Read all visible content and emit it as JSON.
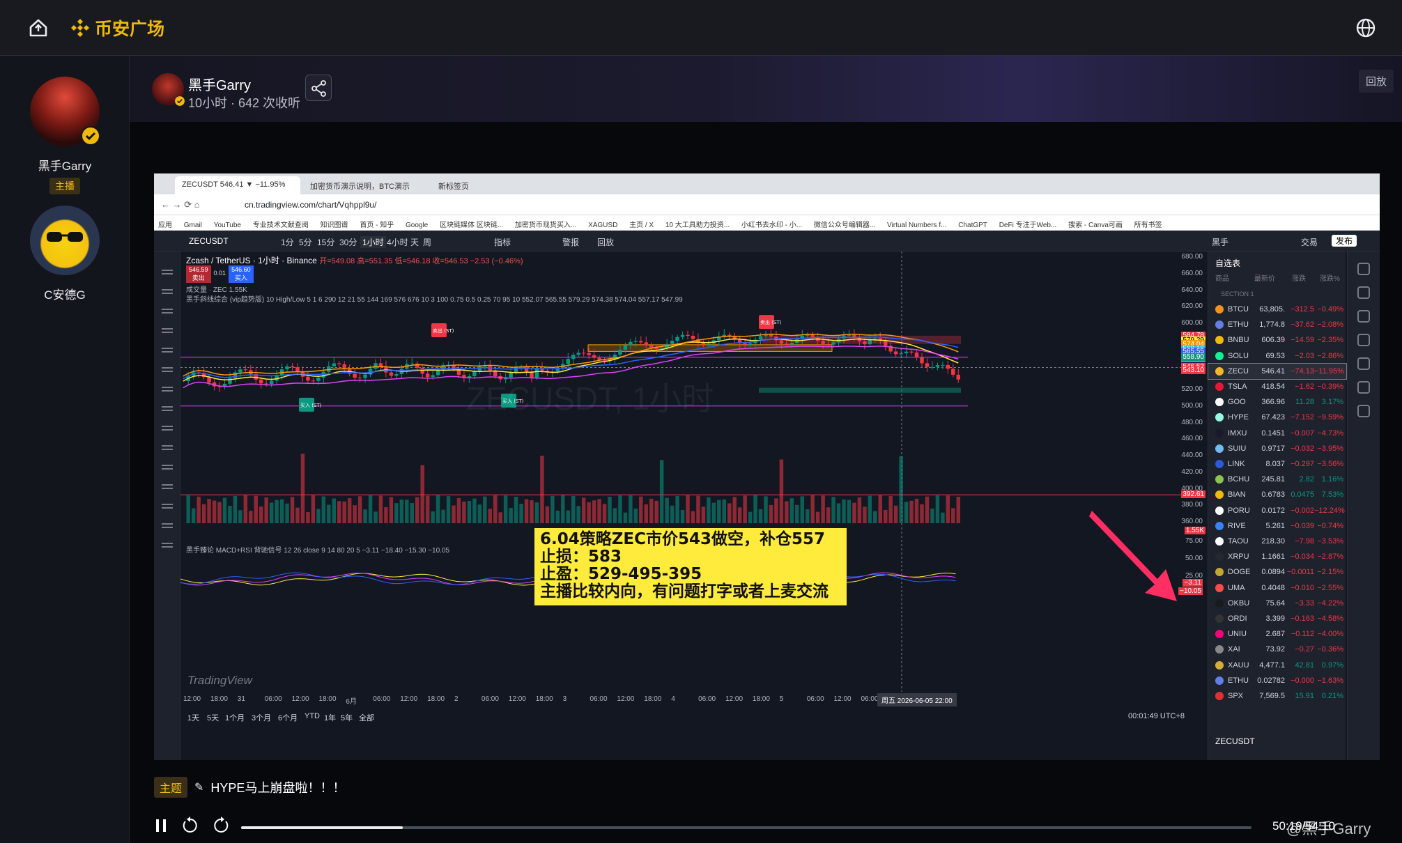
{
  "brand": {
    "title": "币安广场",
    "accent": "#f0b90b"
  },
  "hosts": [
    {
      "name": "黑手Garry",
      "role": "主播"
    },
    {
      "name": "C安德G"
    }
  ],
  "stream": {
    "host_name": "黑手Garry",
    "meta": "10小时 · 642 次收听",
    "replay": "回放"
  },
  "browser": {
    "tabs": [
      "ZECUSDT 546.41 ▼ −11.95%",
      "加密货币演示说明，BTC演示",
      "新标签页"
    ],
    "url": "cn.tradingview.com/chart/Vqhppl9u/",
    "bookmarks": [
      "应用",
      "Gmail",
      "YouTube",
      "专业技术文献查阅",
      "知识图谱",
      "首页 - 知乎",
      "Google",
      "区块链媒体 区块链...",
      "加密货币现货买入...",
      "XAGUSD",
      "主页 / X",
      "10 大工具助力投资...",
      "小红书去水印 - 小...",
      "微信公众号编辑器...",
      "Virtual Numbers f...",
      "ChatGPT",
      "DeFi 专注于Web...",
      "搜索 - Canva可画",
      "所有书签"
    ]
  },
  "tv": {
    "symbol": "ZECUSDT",
    "intervals": [
      "1分",
      "5分",
      "15分",
      "30分",
      "1小时",
      "4小时",
      "天",
      "周"
    ],
    "tools": [
      "指标",
      "警报",
      "回放"
    ],
    "right_tools": [
      "黑手",
      "交易",
      "发布"
    ],
    "legend_title": "Zcash / TetherUS · 1小时 · Binance",
    "legend_ohlc": "开=549.08 高=551.35 低=546.18 收=546.53 −2.53 (−0.46%)",
    "sell_price": "546.59",
    "spread": "0.01",
    "buy_price": "546.60",
    "sell_label": "卖出",
    "buy_label": "买入",
    "volume_label": "成交量 · ZEC 1.55K",
    "indicator_line": "黑手斜线综合 (vip趋势版) 10 High/Low 5 1 6 290 12 21 55 144 169 576 676 10 3 100 0.75 0.5 0.25 70 95 10 552.07 565.55 579.29 574.38 574.04 557.17 547.99",
    "macd_line": "黑手臻论 MACD+RSI 背驰信号 12 26 close 9 14 80 20 5 −3.11 −18.40 −15.30 −10.05",
    "watermark_text": "ZECUSDT, 1小时",
    "logo": "TradingView",
    "note_lines": [
      "6.04策略ZEC市价543做空，补仓557",
      "止损：583",
      "止盈：529-495-395",
      "主播比较内向，有问题打字或者上麦交流"
    ],
    "time_labels": [
      "12:00",
      "18:00",
      "31",
      "06:00",
      "12:00",
      "18:00",
      "6月",
      "06:00",
      "12:00",
      "18:00",
      "2",
      "06:00",
      "12:00",
      "18:00",
      "3",
      "06:00",
      "12:00",
      "18:00",
      "4",
      "06:00",
      "12:00",
      "18:00",
      "5",
      "06:00",
      "12:00",
      "06:00"
    ],
    "cursor_time": "周五 2026-06-05 22:00",
    "ranges": [
      "1天",
      "5天",
      "1个月",
      "3个月",
      "6个月",
      "YTD",
      "1年",
      "5年",
      "全部"
    ],
    "clock": "00:01:49 UTC+8",
    "price_labels": [
      "680.00",
      "660.00",
      "640.00",
      "620.00",
      "600.00",
      "580.00",
      "560.00",
      "540.00",
      "520.00",
      "500.00",
      "480.00",
      "460.00",
      "440.00",
      "420.00",
      "400.00",
      "380.00",
      "360.00"
    ],
    "tag_prices": [
      "584.96",
      "584.78",
      "579.29",
      "574.38",
      "574.04",
      "569.16",
      "565.55",
      "558.41",
      "557.17",
      "558.90",
      "546.53",
      "543.10",
      "392.61",
      "1.55K"
    ],
    "osc_labels": [
      "75.00",
      "50.00",
      "25.00",
      "0.00"
    ],
    "osc_tags": [
      "−3.11",
      "−10.05"
    ],
    "signal_labels": [
      "卖出 (ST)",
      "卖出 (ST)",
      "买入 (ST)",
      "买入 (ST)"
    ]
  },
  "watchlist": {
    "title": "自选表",
    "cols": [
      "商品",
      "最新价",
      "涨跌",
      "涨跌%"
    ],
    "section": "SECTION 1",
    "rows": [
      {
        "sym": "BTCU",
        "last": "63,805.",
        "chg": "−312.5",
        "pct": "−0.49%",
        "color": "#f7931a",
        "dir": "neg"
      },
      {
        "sym": "ETHU",
        "last": "1,774.8",
        "chg": "−37.62",
        "pct": "−2.08%",
        "color": "#627eea",
        "dir": "neg"
      },
      {
        "sym": "BNBU",
        "last": "606.39",
        "chg": "−14.59",
        "pct": "−2.35%",
        "color": "#f0b90b",
        "dir": "neg"
      },
      {
        "sym": "SOLU",
        "last": "69.53",
        "chg": "−2.03",
        "pct": "−2.86%",
        "color": "#14f195",
        "dir": "neg"
      },
      {
        "sym": "ZECU",
        "last": "546.41",
        "chg": "−74.13",
        "pct": "−11.95%",
        "color": "#f4b728",
        "dir": "neg",
        "selected": true
      },
      {
        "sym": "TSLA",
        "last": "418.54",
        "chg": "−1.62",
        "pct": "−0.39%",
        "color": "#e31937",
        "dir": "neg"
      },
      {
        "sym": "GOO",
        "last": "366.96",
        "chg": "11.28",
        "pct": "3.17%",
        "color": "#ffffff",
        "dir": "pos"
      },
      {
        "sym": "HYPE",
        "last": "67.423",
        "chg": "−7.152",
        "pct": "−9.59%",
        "color": "#97fce4",
        "dir": "neg"
      },
      {
        "sym": "IMXU",
        "last": "0.1451",
        "chg": "−0.007",
        "pct": "−4.73%",
        "color": "#1a1a2e",
        "dir": "neg"
      },
      {
        "sym": "SUIU",
        "last": "0.9717",
        "chg": "−0.032",
        "pct": "−3.95%",
        "color": "#6fbcf0",
        "dir": "neg"
      },
      {
        "sym": "LINK",
        "last": "8.037",
        "chg": "−0.297",
        "pct": "−3.56%",
        "color": "#2a5ada",
        "dir": "neg"
      },
      {
        "sym": "BCHU",
        "last": "245.81",
        "chg": "2.82",
        "pct": "1.16%",
        "color": "#8dc351",
        "dir": "pos"
      },
      {
        "sym": "BIAN",
        "last": "0.6783",
        "chg": "0.0475",
        "pct": "7.53%",
        "color": "#f0b90b",
        "dir": "pos"
      },
      {
        "sym": "PORU",
        "last": "0.0172",
        "chg": "−0.002",
        "pct": "−12.24%",
        "color": "#ffffff",
        "dir": "neg"
      },
      {
        "sym": "RIVE",
        "last": "5.261",
        "chg": "−0.039",
        "pct": "−0.74%",
        "color": "#3b82f6",
        "dir": "neg"
      },
      {
        "sym": "TAOU",
        "last": "218.30",
        "chg": "−7.98",
        "pct": "−3.53%",
        "color": "#ffffff",
        "dir": "neg"
      },
      {
        "sym": "XRPU",
        "last": "1.1661",
        "chg": "−0.034",
        "pct": "−2.87%",
        "color": "#23292f",
        "dir": "neg"
      },
      {
        "sym": "DOGE",
        "last": "0.0894",
        "chg": "−0.0011",
        "pct": "−2.15%",
        "color": "#c2a633",
        "dir": "neg"
      },
      {
        "sym": "UMA",
        "last": "0.4048",
        "chg": "−0.010",
        "pct": "−2.55%",
        "color": "#ff4a4a",
        "dir": "neg"
      },
      {
        "sym": "OKBU",
        "last": "75.64",
        "chg": "−3.33",
        "pct": "−4.22%",
        "color": "#1a1a1a",
        "dir": "neg"
      },
      {
        "sym": "ORDI",
        "last": "3.399",
        "chg": "−0.163",
        "pct": "−4.58%",
        "color": "#333333",
        "dir": "neg"
      },
      {
        "sym": "UNIU",
        "last": "2.687",
        "chg": "−0.112",
        "pct": "−4.00%",
        "color": "#ff007a",
        "dir": "neg"
      },
      {
        "sym": "XAI",
        "last": "73.92",
        "chg": "−0.27",
        "pct": "−0.36%",
        "color": "#888888",
        "dir": "neg"
      },
      {
        "sym": "XAUU",
        "last": "4,477.1",
        "chg": "42.81",
        "pct": "0.97%",
        "color": "#d4af37",
        "dir": "pos"
      },
      {
        "sym": "ETHU",
        "last": "0.02782",
        "chg": "−0.000",
        "pct": "−1.63%",
        "color": "#627eea",
        "dir": "neg"
      },
      {
        "sym": "SPX",
        "last": "7,569.5",
        "chg": "15.91",
        "pct": "0.21%",
        "color": "#e03131",
        "dir": "pos"
      }
    ],
    "footer_symbol": "ZECUSDT"
  },
  "topic": {
    "tag": "主题",
    "text": "HYPE马上崩盘啦！！！"
  },
  "player": {
    "progress_percent": 16,
    "time": "50:19/54:10",
    "watermark": "@黑手Garry"
  },
  "chart_data": {
    "type": "candlestick",
    "symbol": "ZECUSDT",
    "interval": "1小时",
    "exchange": "Binance",
    "ylim": [
      360,
      680
    ],
    "last_price": 546.53,
    "levels": {
      "upper_band": 558.9,
      "mid_line": 546.53,
      "low_line": 500,
      "target": 392.61
    }
  }
}
